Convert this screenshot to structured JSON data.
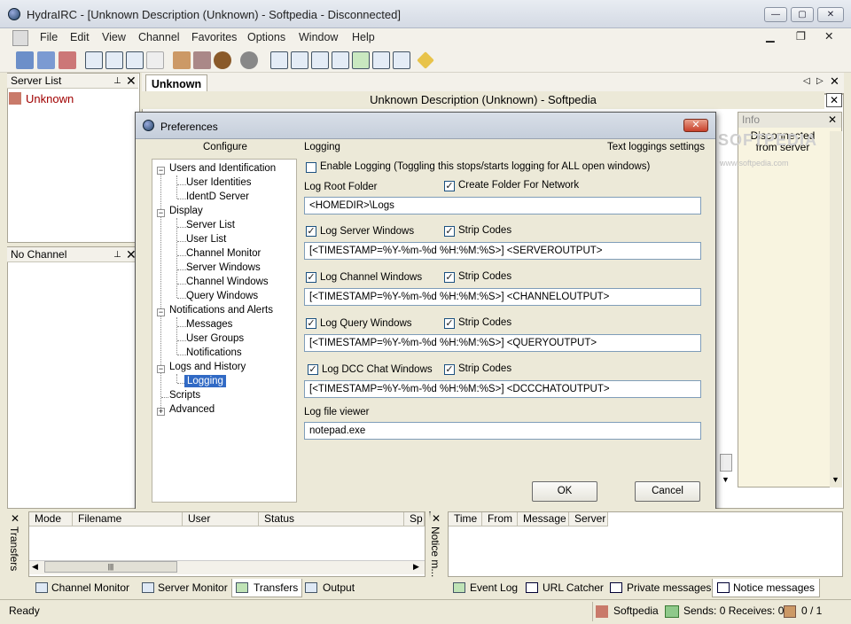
{
  "window": {
    "title": "HydraIRC - [Unknown Description (Unknown) - Softpedia - Disconnected]"
  },
  "menu": [
    "File",
    "Edit",
    "View",
    "Channel",
    "Favorites",
    "Options",
    "Window",
    "Help"
  ],
  "server_list": {
    "title": "Server List",
    "item": "Unknown"
  },
  "channel_panel": {
    "title": "No Channel"
  },
  "main_tab": "Unknown",
  "channel_header": "Unknown Description (Unknown) - Softpedia",
  "info": {
    "title": "Info",
    "message": "Disconnected from server"
  },
  "dialog": {
    "title": "Preferences",
    "configure_label": "Configure",
    "section": "Logging",
    "section_desc": "Text loggings settings",
    "tree": [
      {
        "label": "Users and Identification",
        "children": [
          "User Identities",
          "IdentD Server"
        ]
      },
      {
        "label": "Display",
        "children": [
          "Server List",
          "User List",
          "Channel Monitor",
          "Server Windows",
          "Channel Windows",
          "Query Windows"
        ]
      },
      {
        "label": "Notifications and Alerts",
        "children": [
          "Messages",
          "User Groups",
          "Notifications"
        ]
      },
      {
        "label": "Logs and History",
        "children": [
          "Logging"
        ]
      },
      {
        "label": "Scripts",
        "children": []
      },
      {
        "label": "Advanced",
        "children": []
      }
    ],
    "selected_item": "Logging",
    "enable_logging": {
      "label": "Enable Logging (Toggling this stops/starts logging for ALL open windows)",
      "checked": false
    },
    "log_root": {
      "label": "Log Root Folder",
      "value": "<HOMEDIR>\\Logs"
    },
    "create_folder": {
      "label": "Create Folder For Network",
      "checked": true
    },
    "strip_label": "Strip Codes",
    "logs": [
      {
        "label": "Log Server Windows",
        "checked": true,
        "strip": true,
        "value": "[<TIMESTAMP=%Y-%m-%d %H:%M:%S>] <SERVEROUTPUT>"
      },
      {
        "label": "Log Channel Windows",
        "checked": true,
        "strip": true,
        "value": "[<TIMESTAMP=%Y-%m-%d %H:%M:%S>] <CHANNELOUTPUT>"
      },
      {
        "label": "Log Query Windows",
        "checked": true,
        "strip": true,
        "value": "[<TIMESTAMP=%Y-%m-%d %H:%M:%S>] <QUERYOUTPUT>"
      },
      {
        "label": "Log DCC Chat Windows",
        "checked": true,
        "strip": true,
        "value": "[<TIMESTAMP=%Y-%m-%d %H:%M:%S>] <DCCCHATOUTPUT>"
      }
    ],
    "viewer": {
      "label": "Log file viewer",
      "value": "notepad.exe"
    },
    "ok": "OK",
    "cancel": "Cancel"
  },
  "transfers": {
    "side_label": "Transfers",
    "columns": [
      "Mode",
      "Filename",
      "User",
      "Status",
      "Sp"
    ]
  },
  "notices": {
    "side_label": "Notice m...",
    "columns": [
      "Time",
      "From",
      "Message",
      "Server"
    ]
  },
  "bottom_tabs_left": [
    "Channel Monitor",
    "Server Monitor",
    "Transfers",
    "Output"
  ],
  "bottom_tabs_right": [
    "Event Log",
    "URL Catcher",
    "Private messages",
    "Notice messages"
  ],
  "status": {
    "text": "Ready",
    "network": "Softpedia",
    "sends": "Sends: 0 Receives: 0",
    "count": "0 / 1"
  },
  "watermark": "SOFTPEDIA",
  "watermark_url": "www.softpedia.com"
}
